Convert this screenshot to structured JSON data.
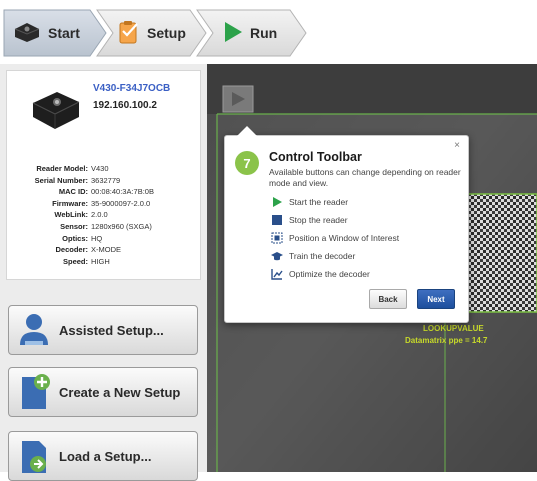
{
  "wizard": {
    "steps": [
      {
        "label": "Start",
        "icon": "reader-device-icon"
      },
      {
        "label": "Setup",
        "icon": "setup-clipboard-icon"
      },
      {
        "label": "Run",
        "icon": "play-icon"
      }
    ]
  },
  "device": {
    "name": "V430-F34J7OCB",
    "ip": "192.160.100.2",
    "specs": [
      {
        "key": "Reader Model:",
        "value": "V430"
      },
      {
        "key": "Serial Number:",
        "value": "3632779"
      },
      {
        "key": "MAC ID:",
        "value": "00:08:40:3A:7B:0B"
      },
      {
        "key": "Firmware:",
        "value": "35-9000097-2.0.0"
      },
      {
        "key": "WebLink:",
        "value": "2.0.0"
      },
      {
        "key": "Sensor:",
        "value": "1280x960 (SXGA)"
      },
      {
        "key": "Optics:",
        "value": "HQ"
      },
      {
        "key": "Decoder:",
        "value": "X-MODE"
      },
      {
        "key": "Speed:",
        "value": "HIGH"
      }
    ]
  },
  "actions": {
    "assisted": "Assisted Setup...",
    "create": "Create a New Setup",
    "load": "Load a Setup..."
  },
  "popup": {
    "step": "7",
    "title": "Control Toolbar",
    "close": "×",
    "description": "Available buttons can change depending on reader mode and view.",
    "items": [
      {
        "label": "Start the reader",
        "icon": "play-icon"
      },
      {
        "label": "Stop the reader",
        "icon": "stop-icon"
      },
      {
        "label": "Position a Window of Interest",
        "icon": "window-of-interest-icon"
      },
      {
        "label": "Train the decoder",
        "icon": "train-hat-icon"
      },
      {
        "label": "Optimize the decoder",
        "icon": "optimize-chart-icon"
      }
    ],
    "back": "Back",
    "next": "Next"
  },
  "camera": {
    "code_label": "LOOKUPVALUE",
    "overlay_label": "Datamatrix ppe = 14.7"
  },
  "colors": {
    "accent_green": "#8bc34a",
    "link_blue": "#3a5fc4",
    "next_blue": "#1d4f9d",
    "play_green": "#2ca24a"
  }
}
